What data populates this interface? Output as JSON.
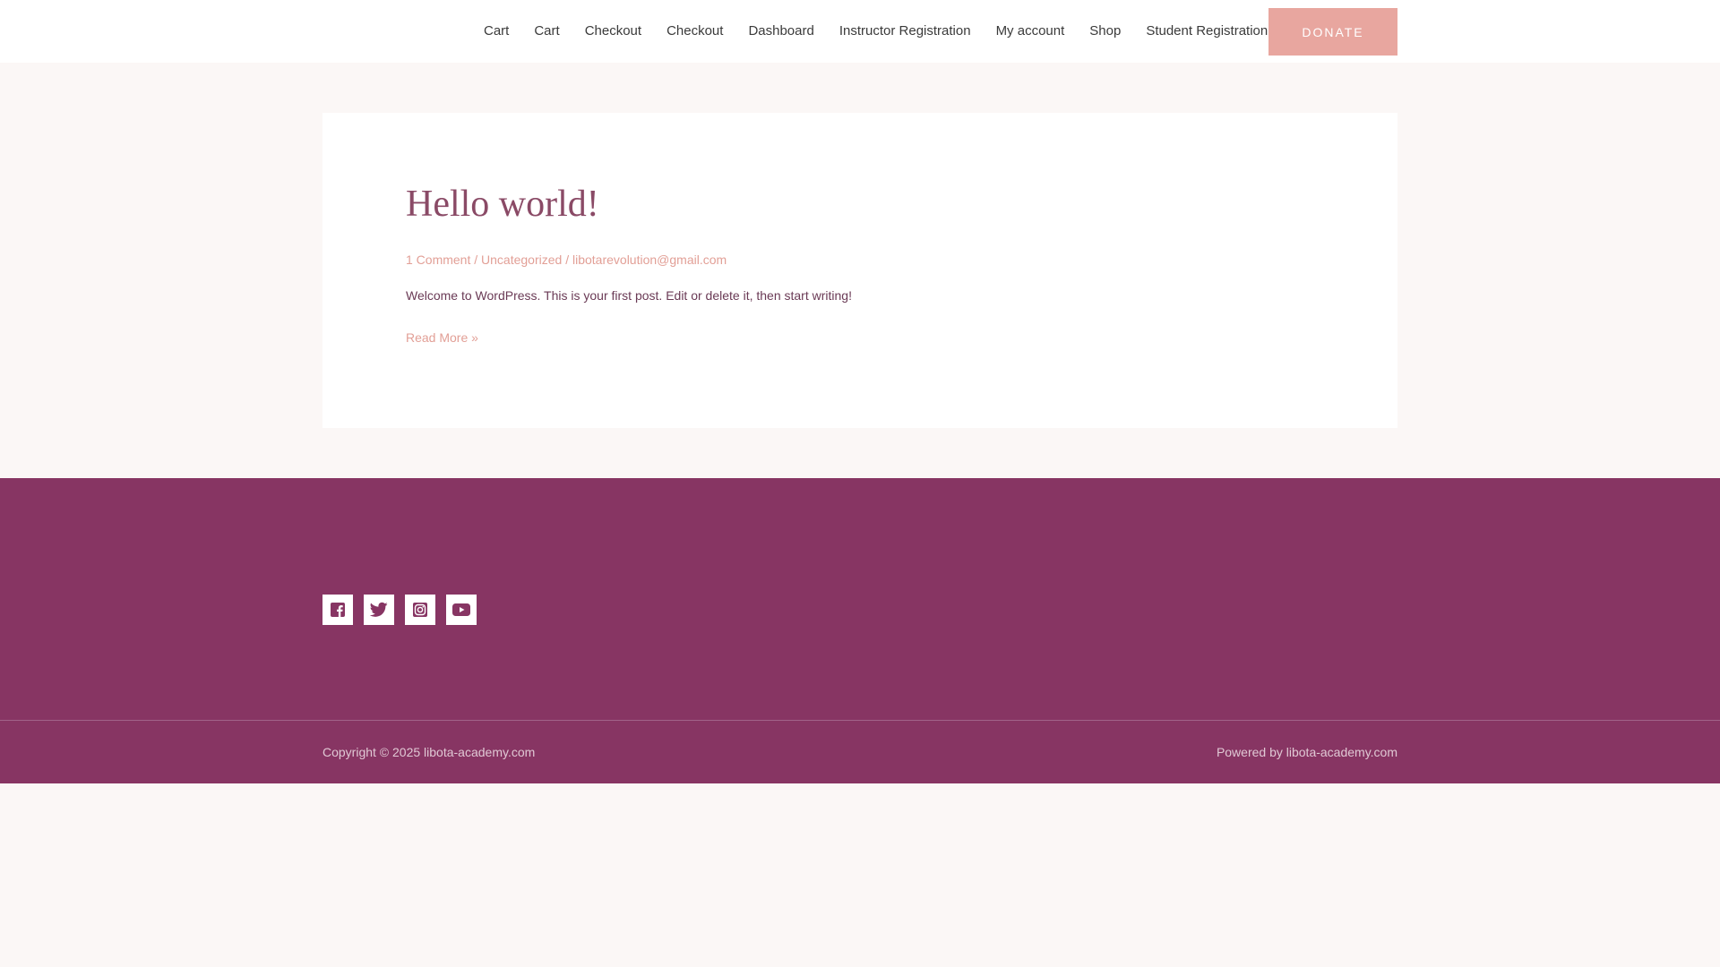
{
  "header": {
    "nav": [
      "Cart",
      "Cart",
      "Checkout",
      "Checkout",
      "Dashboard",
      "Instructor Registration",
      "My account",
      "Shop",
      "Student Registration"
    ],
    "donate_label": "DONATE"
  },
  "post": {
    "title": "Hello world!",
    "meta": {
      "comments": "1 Comment",
      "sep1": " / ",
      "category": "Uncategorized",
      "sep2": " / ",
      "author": "libotarevolution@gmail.com"
    },
    "excerpt": "Welcome to WordPress. This is your first post. Edit or delete it, then start writing!",
    "read_more": "Read More »"
  },
  "footer": {
    "social": [
      {
        "icon": "facebook-icon"
      },
      {
        "icon": "twitter-icon"
      },
      {
        "icon": "instagram-icon"
      },
      {
        "icon": "youtube-icon"
      }
    ],
    "copyright": "Copyright © 2025 libota-academy.com",
    "powered": "Powered by libota-academy.com"
  },
  "colors": {
    "accent": "#e8a69f",
    "footer_bg": "#873563",
    "title": "#8a4a66",
    "page_bg": "#fbf7f6"
  }
}
